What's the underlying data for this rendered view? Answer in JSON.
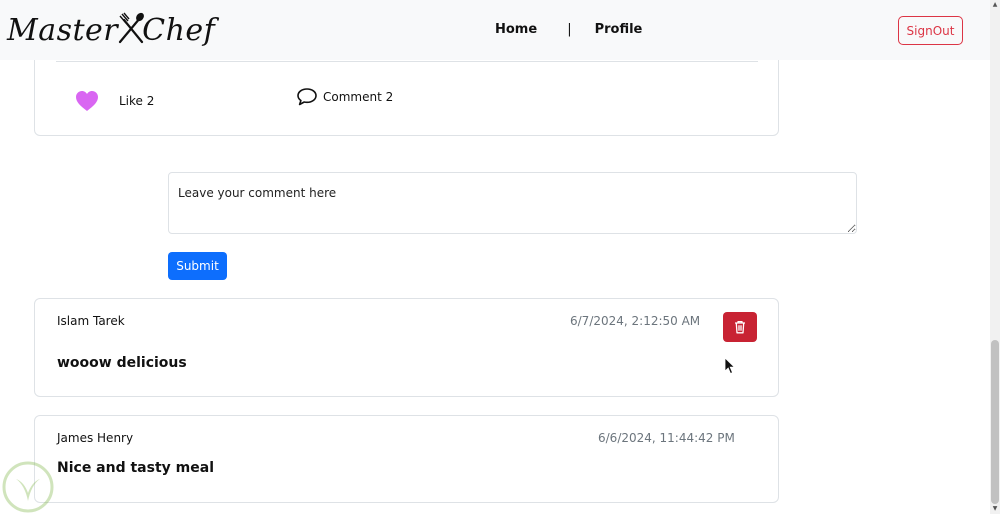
{
  "brand": {
    "name_left": "Master",
    "name_right": "Chef"
  },
  "nav": {
    "home": "Home",
    "separator": "|",
    "profile": "Profile",
    "signout": "SignOut"
  },
  "post": {
    "like_label": "Like 2",
    "comment_label": "Comment 2"
  },
  "comment_form": {
    "placeholder": "Leave your comment here",
    "submit_label": "Submit"
  },
  "comments": [
    {
      "author": "Islam Tarek",
      "time": "6/7/2024, 2:12:50 AM",
      "text": "wooow delicious"
    },
    {
      "author": "James Henry",
      "time": "6/6/2024, 11:44:42 PM",
      "text": "Nice and tasty meal"
    }
  ],
  "colors": {
    "primary": "#0d6efd",
    "danger": "#dc3545",
    "heart": "#d966f2",
    "navbar": "#f8f9fa"
  },
  "icons": [
    "heart-icon",
    "comment-icon",
    "trash-icon",
    "utensils-icon"
  ]
}
